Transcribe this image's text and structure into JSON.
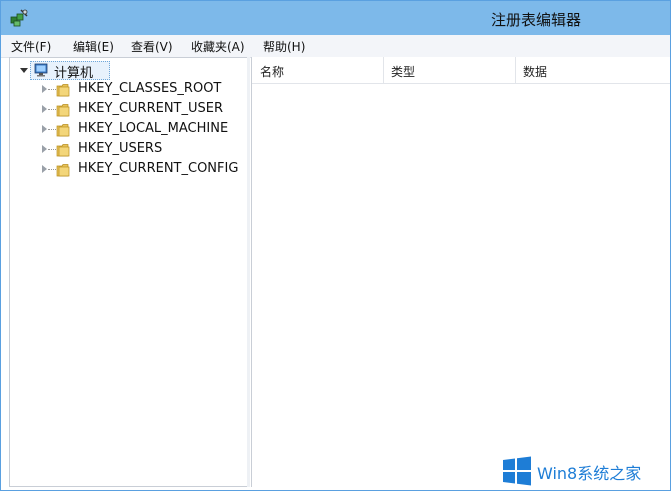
{
  "window": {
    "title": "注册表编辑器",
    "icon": "regedit-icon"
  },
  "menu": {
    "items": [
      "文件(F)",
      "编辑(E)",
      "查看(V)",
      "收藏夹(A)",
      "帮助(H)"
    ]
  },
  "tree": {
    "root_label": "计算机",
    "root_icon": "computer-icon",
    "children": [
      {
        "label": "HKEY_CLASSES_ROOT",
        "icon": "folder-icon"
      },
      {
        "label": "HKEY_CURRENT_USER",
        "icon": "folder-icon"
      },
      {
        "label": "HKEY_LOCAL_MACHINE",
        "icon": "folder-icon"
      },
      {
        "label": "HKEY_USERS",
        "icon": "folder-icon"
      },
      {
        "label": "HKEY_CURRENT_CONFIG",
        "icon": "folder-icon"
      }
    ]
  },
  "list": {
    "columns": [
      "名称",
      "类型",
      "数据"
    ]
  },
  "watermark": {
    "text": "Win8系统之家",
    "color": "#1e7dd6"
  },
  "colors": {
    "titlebar": "#7db9ea",
    "window_border": "#5aa0e0"
  }
}
